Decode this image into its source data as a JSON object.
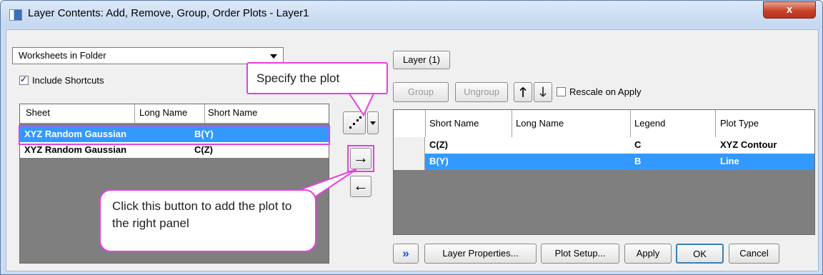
{
  "window": {
    "title": "Layer Contents: Add, Remove, Group, Order Plots - Layer1",
    "close_glyph": "x"
  },
  "left_panel": {
    "source_select": "Worksheets in Folder",
    "include_shortcuts": {
      "label": "Include Shortcuts",
      "checked": true
    },
    "columns": [
      "Sheet",
      "Long Name",
      "Short Name"
    ],
    "rows": [
      {
        "sheet": "XYZ Random Gaussian",
        "short_name": "B(Y)",
        "selected": true
      },
      {
        "sheet": "XYZ Random Gaussian",
        "short_name": "C(Z)",
        "selected": false
      }
    ]
  },
  "middle": {
    "plot_type_icon": "scatter-plot-icon",
    "add_arrow": "→",
    "remove_arrow": "←"
  },
  "right_panel": {
    "layer_button": "Layer (1)",
    "group_button": "Group",
    "ungroup_button": "Ungroup",
    "up_arrow": "🡑",
    "down_arrow": "🡓",
    "rescale": {
      "label": "Rescale on Apply",
      "checked": false
    },
    "columns": [
      "Short Name",
      "Long Name",
      "Legend",
      "Plot Type"
    ],
    "rows": [
      {
        "short_name": "C(Z)",
        "long_name": "",
        "legend": "C",
        "plot_type": "XYZ Contour",
        "selected": false
      },
      {
        "short_name": "B(Y)",
        "long_name": "",
        "legend": "B",
        "plot_type": "Line",
        "selected": true
      }
    ]
  },
  "buttons": {
    "more": "»",
    "layer_properties": "Layer Properties...",
    "plot_setup": "Plot Setup...",
    "apply": "Apply",
    "ok": "OK",
    "cancel": "Cancel"
  },
  "annotations": {
    "specify_plot": "Specify the plot",
    "click_button": "Click this button to add the plot to the right panel"
  },
  "colors": {
    "highlight": "#e83ee0",
    "selection": "#3399ff",
    "grid_background": "#7f7f7f"
  }
}
